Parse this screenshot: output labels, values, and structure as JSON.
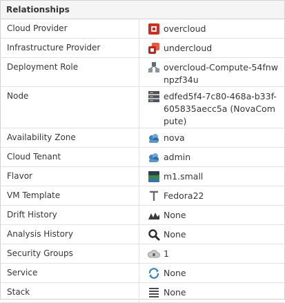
{
  "panel": {
    "title": "Relationships"
  },
  "rows": [
    {
      "label": "Cloud Provider",
      "value": "overcloud",
      "icon": "openstack-cloud-provider-icon"
    },
    {
      "label": "Infrastructure Provider",
      "value": "undercloud",
      "icon": "openstack-infra-provider-icon"
    },
    {
      "label": "Deployment Role",
      "value": "overcloud-Compute-54fnwnpzf34u",
      "icon": "deployment-role-icon"
    },
    {
      "label": "Node",
      "value": "edfed5f4-7c80-468a-b33f-605835aecc5a (NovaCompute)",
      "icon": "server-node-icon"
    },
    {
      "label": "Availability Zone",
      "value": "nova",
      "icon": "availability-zone-icon"
    },
    {
      "label": "Cloud Tenant",
      "value": "admin",
      "icon": "cloud-tenant-icon"
    },
    {
      "label": "Flavor",
      "value": "m1.small",
      "icon": "flavor-icon"
    },
    {
      "label": "VM Template",
      "value": "Fedora22",
      "icon": "vm-template-icon"
    },
    {
      "label": "Drift History",
      "value": "None",
      "icon": "drift-history-icon"
    },
    {
      "label": "Analysis History",
      "value": "None",
      "icon": "magnifier-icon"
    },
    {
      "label": "Security Groups",
      "value": "1",
      "icon": "security-group-icon"
    },
    {
      "label": "Service",
      "value": "None",
      "icon": "service-icon"
    },
    {
      "label": "Stack",
      "value": "None",
      "icon": "stack-icon"
    }
  ]
}
